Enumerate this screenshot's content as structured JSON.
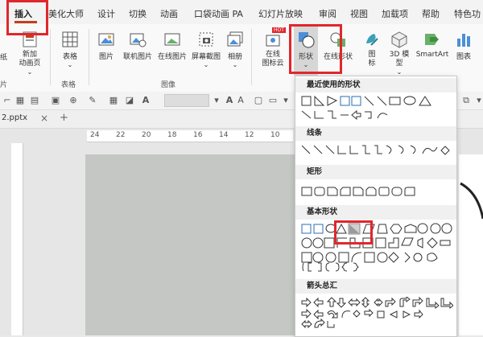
{
  "tabs": [
    {
      "label": "插入",
      "active": true
    },
    {
      "label": "美化大师"
    },
    {
      "label": "设计"
    },
    {
      "label": "切换"
    },
    {
      "label": "动画"
    },
    {
      "label": "口袋动画 PA"
    },
    {
      "label": "幻灯片放映"
    },
    {
      "label": "审阅"
    },
    {
      "label": "视图"
    },
    {
      "label": "加载项"
    },
    {
      "label": "帮助"
    },
    {
      "label": "特色功"
    }
  ],
  "ribbon": {
    "left_partial": "纸",
    "left_partial_group": "片",
    "new_anim_page": "新加\n动画页",
    "new_anim_page_caret": "⌄",
    "table": "表格",
    "table_caret": "⌄",
    "table_group": "表格",
    "picture": "图片",
    "online_picture": "联机图片",
    "online_picture2": "在线图片",
    "screenshot": "屏幕截图",
    "screenshot_caret": "⌄",
    "album": "相册",
    "album_caret": "⌄",
    "image_group": "图像",
    "online_icons": "在线\n图标云",
    "hot_badge": "HOT",
    "shapes": "形状",
    "shapes_caret": "⌄",
    "online_shapes": "在线形状",
    "icons": "图\n标",
    "model3d": "3D 模\n型",
    "model3d_caret": "⌄",
    "smartart": "SmartArt",
    "chart": "图表"
  },
  "fmtbar": {
    "A1": "A",
    "A2": "A",
    "A3": "A"
  },
  "file": {
    "name": "2.pptx",
    "close": "×",
    "add": "+"
  },
  "ruler": {
    "marks": [
      "24",
      "22",
      "20",
      "18",
      "16",
      "14",
      "12",
      "10"
    ]
  },
  "dropdown": {
    "recent": "最近使用的形状",
    "lines": "线条",
    "rect": "矩形",
    "basic": "基本形状",
    "arrows": "箭头总汇"
  },
  "colors": {
    "accent": "#c43e1c",
    "highlight": "#e0272d",
    "slide_gray": "#c4c7c4"
  },
  "icons": [
    "table-icon",
    "picture-icon",
    "online-picture-icon",
    "screenshot-icon",
    "album-icon",
    "online-icons-icon",
    "shapes-icon",
    "online-shapes-icon",
    "icons-icon",
    "3d-model-icon",
    "smartart-icon",
    "chart-icon"
  ]
}
